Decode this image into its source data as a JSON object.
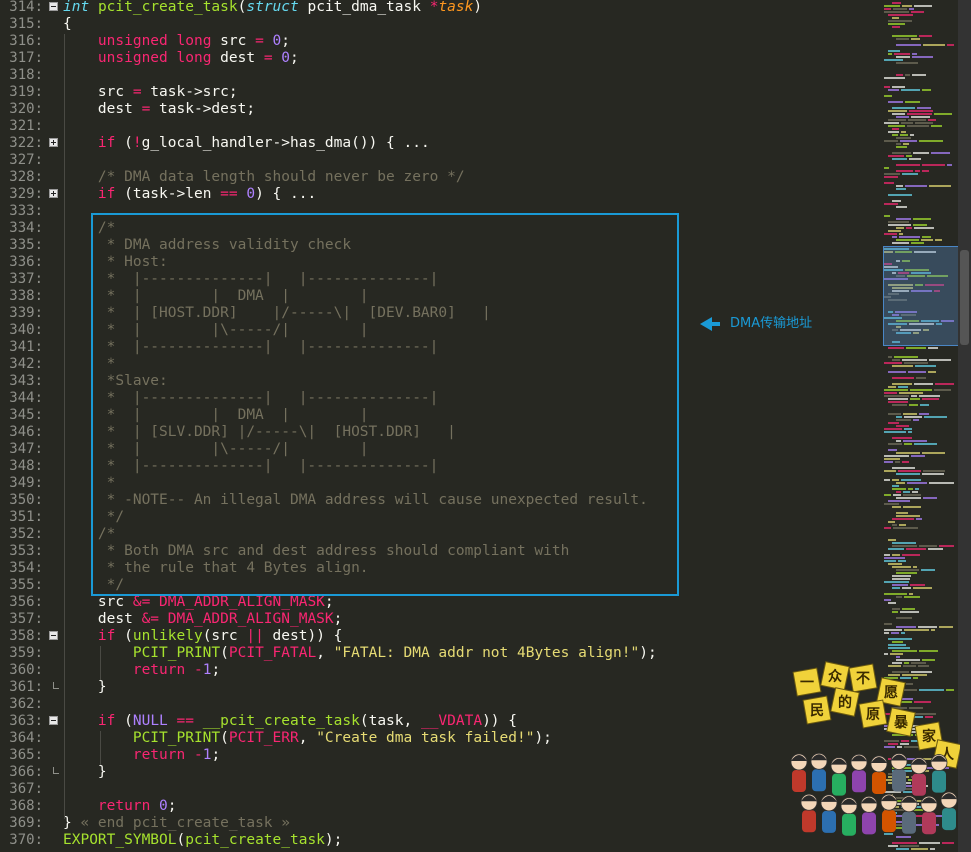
{
  "editor": {
    "lines": [
      {
        "n": "314:",
        "fold": "minus",
        "seg": [
          [
            "t",
            "int"
          ],
          [
            "v",
            " "
          ],
          [
            "f",
            "pcit_create_task"
          ],
          [
            "v",
            "("
          ],
          [
            "t",
            "struct"
          ],
          [
            "v",
            " pcit_dma_task "
          ],
          [
            "k",
            "*"
          ],
          [
            "p",
            "task"
          ],
          [
            "v",
            ")"
          ]
        ]
      },
      {
        "n": "315:",
        "seg": [
          [
            "v",
            "{"
          ]
        ]
      },
      {
        "n": "316:",
        "seg": [
          [
            "v",
            "    "
          ],
          [
            "k",
            "unsigned"
          ],
          [
            "v",
            " "
          ],
          [
            "k",
            "long"
          ],
          [
            "v",
            " src "
          ],
          [
            "k",
            "="
          ],
          [
            "v",
            " "
          ],
          [
            "n",
            "0"
          ],
          [
            "v",
            ";"
          ]
        ]
      },
      {
        "n": "317:",
        "seg": [
          [
            "v",
            "    "
          ],
          [
            "k",
            "unsigned"
          ],
          [
            "v",
            " "
          ],
          [
            "k",
            "long"
          ],
          [
            "v",
            " dest "
          ],
          [
            "k",
            "="
          ],
          [
            "v",
            " "
          ],
          [
            "n",
            "0"
          ],
          [
            "v",
            ";"
          ]
        ]
      },
      {
        "n": "318:",
        "seg": []
      },
      {
        "n": "319:",
        "seg": [
          [
            "v",
            "    src "
          ],
          [
            "k",
            "="
          ],
          [
            "v",
            " task->src;"
          ]
        ]
      },
      {
        "n": "320:",
        "seg": [
          [
            "v",
            "    dest "
          ],
          [
            "k",
            "="
          ],
          [
            "v",
            " task->dest;"
          ]
        ]
      },
      {
        "n": "321:",
        "seg": []
      },
      {
        "n": "322:",
        "fold": "plus",
        "seg": [
          [
            "v",
            "    "
          ],
          [
            "k",
            "if"
          ],
          [
            "v",
            " ("
          ],
          [
            "k",
            "!"
          ],
          [
            "v",
            "g_local_handler->has_dma()) { ..."
          ]
        ]
      },
      {
        "n": "327:",
        "seg": []
      },
      {
        "n": "328:",
        "seg": [
          [
            "v",
            "    "
          ],
          [
            "c",
            "/* DMA data length should never be zero */"
          ]
        ]
      },
      {
        "n": "329:",
        "fold": "plus",
        "seg": [
          [
            "v",
            "    "
          ],
          [
            "k",
            "if"
          ],
          [
            "v",
            " (task->len "
          ],
          [
            "k",
            "=="
          ],
          [
            "v",
            " "
          ],
          [
            "n",
            "0"
          ],
          [
            "v",
            ") { ..."
          ]
        ]
      },
      {
        "n": "333:",
        "seg": []
      },
      {
        "n": "334:",
        "seg": [
          [
            "v",
            "    "
          ],
          [
            "c",
            "/*"
          ]
        ]
      },
      {
        "n": "335:",
        "seg": [
          [
            "c",
            "     * DMA address validity check"
          ]
        ]
      },
      {
        "n": "336:",
        "seg": [
          [
            "c",
            "     * Host:"
          ]
        ]
      },
      {
        "n": "337:",
        "seg": [
          [
            "c",
            "     *  |--------------|   |--------------|"
          ]
        ]
      },
      {
        "n": "338:",
        "seg": [
          [
            "c",
            "     *  |        |  DMA  |        |"
          ]
        ]
      },
      {
        "n": "339:",
        "seg": [
          [
            "c",
            "     *  | [HOST.DDR]    |/-----\\|  [DEV.BAR0]   |"
          ]
        ]
      },
      {
        "n": "340:",
        "seg": [
          [
            "c",
            "     *  |        |\\-----/|        |"
          ]
        ]
      },
      {
        "n": "341:",
        "seg": [
          [
            "c",
            "     *  |--------------|   |--------------|"
          ]
        ]
      },
      {
        "n": "342:",
        "seg": [
          [
            "c",
            "     *"
          ]
        ]
      },
      {
        "n": "343:",
        "seg": [
          [
            "c",
            "     *Slave:"
          ]
        ]
      },
      {
        "n": "344:",
        "seg": [
          [
            "c",
            "     *  |--------------|   |--------------|"
          ]
        ]
      },
      {
        "n": "345:",
        "seg": [
          [
            "c",
            "     *  |        |  DMA  |        |"
          ]
        ]
      },
      {
        "n": "346:",
        "seg": [
          [
            "c",
            "     *  | [SLV.DDR] |/-----\\|  [HOST.DDR]   |"
          ]
        ]
      },
      {
        "n": "347:",
        "seg": [
          [
            "c",
            "     *  |        |\\-----/|        |"
          ]
        ]
      },
      {
        "n": "348:",
        "seg": [
          [
            "c",
            "     *  |--------------|   |--------------|"
          ]
        ]
      },
      {
        "n": "349:",
        "seg": [
          [
            "c",
            "     *"
          ]
        ]
      },
      {
        "n": "350:",
        "seg": [
          [
            "c",
            "     * -NOTE-- An illegal DMA address will cause unexpected result."
          ]
        ]
      },
      {
        "n": "351:",
        "seg": [
          [
            "c",
            "     */"
          ]
        ]
      },
      {
        "n": "352:",
        "seg": [
          [
            "v",
            "    "
          ],
          [
            "c",
            "/*"
          ]
        ]
      },
      {
        "n": "353:",
        "seg": [
          [
            "c",
            "     * Both DMA src and dest address should compliant with"
          ]
        ]
      },
      {
        "n": "354:",
        "seg": [
          [
            "c",
            "     * the rule that 4 Bytes align."
          ]
        ]
      },
      {
        "n": "355:",
        "seg": [
          [
            "c",
            "     */"
          ]
        ]
      },
      {
        "n": "356:",
        "seg": [
          [
            "v",
            "    src "
          ],
          [
            "k",
            "&="
          ],
          [
            "v",
            " "
          ],
          [
            "k",
            "DMA_ADDR_ALIGN_MASK"
          ],
          [
            "v",
            ";"
          ]
        ]
      },
      {
        "n": "357:",
        "seg": [
          [
            "v",
            "    dest "
          ],
          [
            "k",
            "&="
          ],
          [
            "v",
            " "
          ],
          [
            "k",
            "DMA_ADDR_ALIGN_MASK"
          ],
          [
            "v",
            ";"
          ]
        ]
      },
      {
        "n": "358:",
        "fold": "minus",
        "seg": [
          [
            "v",
            "    "
          ],
          [
            "k",
            "if"
          ],
          [
            "v",
            " ("
          ],
          [
            "f",
            "unlikely"
          ],
          [
            "v",
            "(src "
          ],
          [
            "k",
            "||"
          ],
          [
            "v",
            " dest)) {"
          ]
        ]
      },
      {
        "n": "359:",
        "seg": [
          [
            "v",
            "        "
          ],
          [
            "f",
            "PCIT_PRINT"
          ],
          [
            "v",
            "("
          ],
          [
            "k",
            "PCIT_FATAL"
          ],
          [
            "v",
            ", "
          ],
          [
            "s",
            "\"FATAL: DMA addr not 4Bytes align!\""
          ],
          [
            "v",
            ");"
          ]
        ]
      },
      {
        "n": "360:",
        "seg": [
          [
            "v",
            "        "
          ],
          [
            "k",
            "return"
          ],
          [
            "v",
            " "
          ],
          [
            "k",
            "-"
          ],
          [
            "n",
            "1"
          ],
          [
            "v",
            ";"
          ]
        ]
      },
      {
        "n": "361:",
        "end": true,
        "seg": [
          [
            "v",
            "    }"
          ]
        ]
      },
      {
        "n": "362:",
        "seg": []
      },
      {
        "n": "363:",
        "fold": "minus",
        "seg": [
          [
            "v",
            "    "
          ],
          [
            "k",
            "if"
          ],
          [
            "v",
            " ("
          ],
          [
            "n",
            "NULL"
          ],
          [
            "v",
            " "
          ],
          [
            "k",
            "=="
          ],
          [
            "v",
            " "
          ],
          [
            "f",
            "__pcit_create_task"
          ],
          [
            "v",
            "(task, "
          ],
          [
            "k",
            "__VDATA"
          ],
          [
            "v",
            ")) {"
          ]
        ]
      },
      {
        "n": "364:",
        "seg": [
          [
            "v",
            "        "
          ],
          [
            "f",
            "PCIT_PRINT"
          ],
          [
            "v",
            "("
          ],
          [
            "k",
            "PCIT_ERR"
          ],
          [
            "v",
            ", "
          ],
          [
            "s",
            "\"Create dma task failed!\""
          ],
          [
            "v",
            ");"
          ]
        ]
      },
      {
        "n": "365:",
        "seg": [
          [
            "v",
            "        "
          ],
          [
            "k",
            "return"
          ],
          [
            "v",
            " "
          ],
          [
            "k",
            "-"
          ],
          [
            "n",
            "1"
          ],
          [
            "v",
            ";"
          ]
        ]
      },
      {
        "n": "366:",
        "end": true,
        "seg": [
          [
            "v",
            "    }"
          ]
        ]
      },
      {
        "n": "367:",
        "seg": []
      },
      {
        "n": "368:",
        "seg": [
          [
            "v",
            "    "
          ],
          [
            "k",
            "return"
          ],
          [
            "v",
            " "
          ],
          [
            "n",
            "0"
          ],
          [
            "v",
            ";"
          ]
        ]
      },
      {
        "n": "369:",
        "seg": [
          [
            "v",
            "} "
          ],
          [
            "c",
            "« end pcit_create_task »"
          ]
        ]
      },
      {
        "n": "370:",
        "seg": [
          [
            "f",
            "EXPORT_SYMBOL"
          ],
          [
            "v",
            "("
          ],
          [
            "f",
            "pcit_create_task"
          ],
          [
            "v",
            ");"
          ]
        ]
      }
    ]
  },
  "annotation": {
    "label": "DMA传输地址",
    "color": "#1a9ad6"
  },
  "sticker": {
    "chars": [
      "一",
      "众",
      "不",
      "愿",
      "民",
      "的",
      "原",
      "暴",
      "家",
      "人"
    ]
  },
  "theme": {
    "background": "#272822",
    "keyword": "#f92672",
    "type": "#66d9ef",
    "function": "#a6e22e",
    "number": "#ae81ff",
    "string": "#e6db74",
    "comment": "#75715e",
    "text": "#f8f8f2",
    "param": "#fd971f"
  }
}
